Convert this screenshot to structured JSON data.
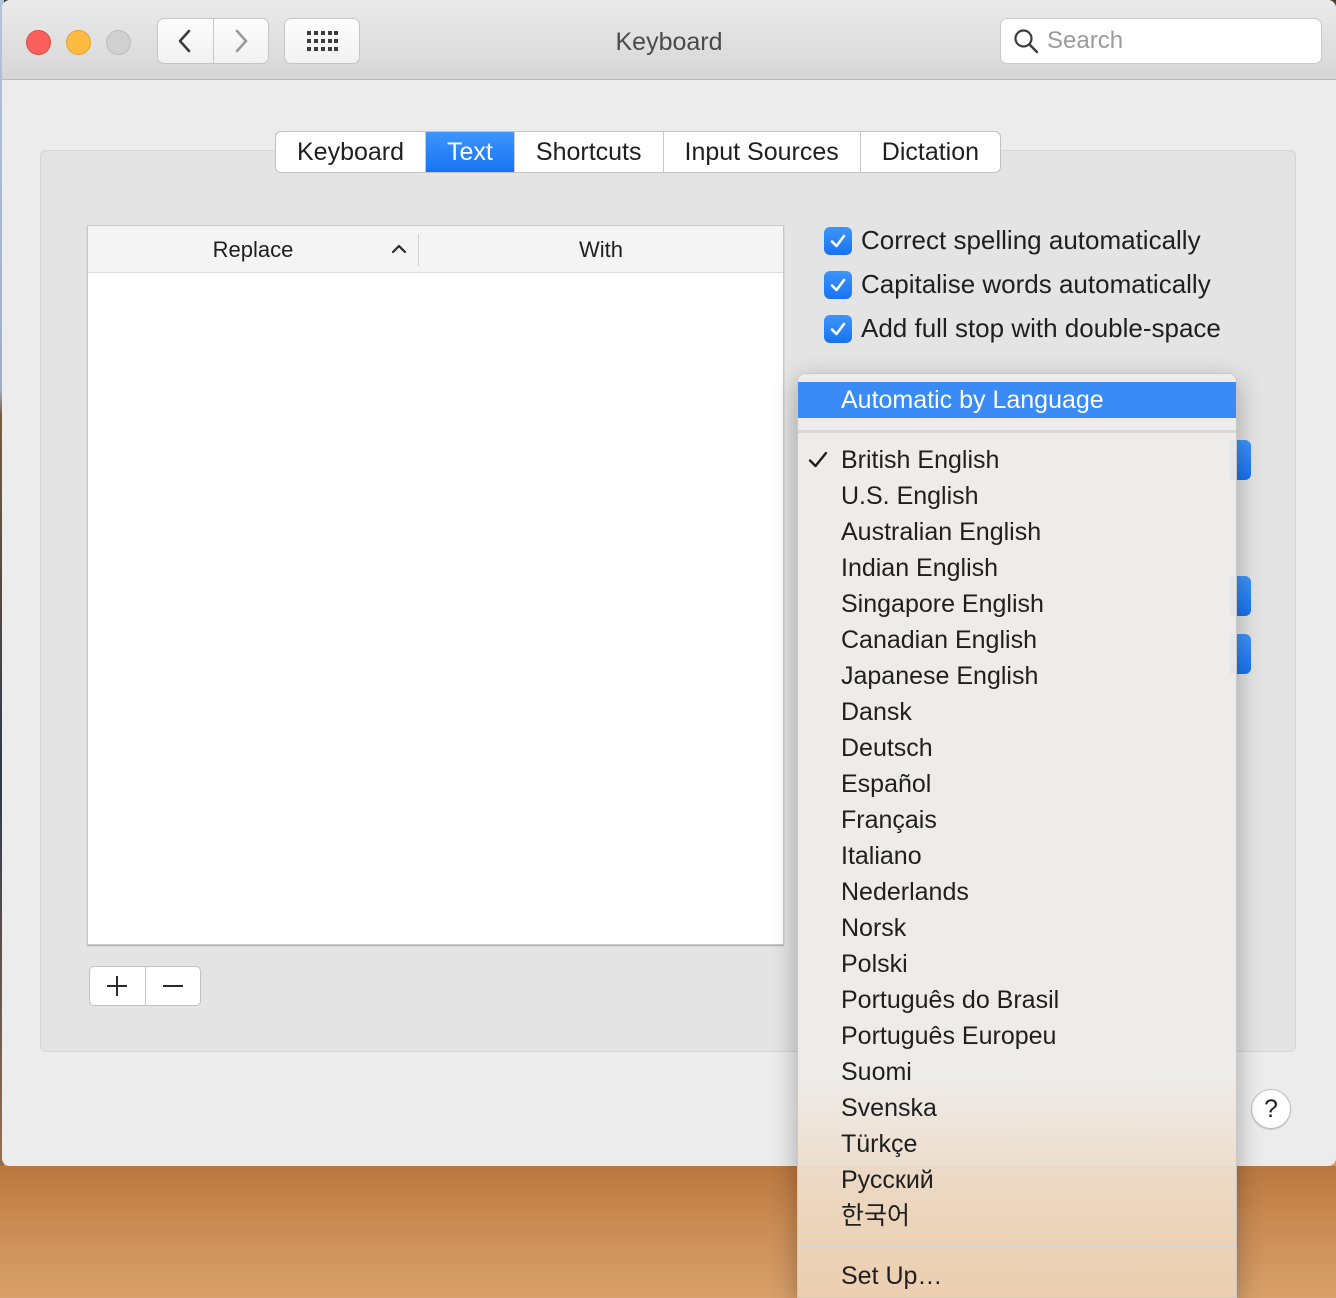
{
  "window": {
    "title": "Keyboard",
    "search_placeholder": "Search"
  },
  "tabs": [
    {
      "label": "Keyboard"
    },
    {
      "label": "Text"
    },
    {
      "label": "Shortcuts"
    },
    {
      "label": "Input Sources"
    },
    {
      "label": "Dictation"
    }
  ],
  "active_tab": "Text",
  "table": {
    "col_replace": "Replace",
    "col_with": "With",
    "sort": "ascending"
  },
  "options": {
    "spelling": "Correct spelling automatically",
    "capitalise": "Capitalise words automatically",
    "full_stop": "Add full stop with double-space"
  },
  "menu": {
    "top": "Automatic by Language",
    "languages": [
      "British English",
      "U.S. English",
      "Australian English",
      "Indian English",
      "Singapore English",
      "Canadian English",
      "Japanese English",
      "Dansk",
      "Deutsch",
      "Español",
      "Français",
      "Italiano",
      "Nederlands",
      "Norsk",
      "Polski",
      "Português do Brasil",
      "Português Europeu",
      "Suomi",
      "Svenska",
      "Türkçe",
      "Русский",
      "한국어"
    ],
    "checked": "British English",
    "setup": "Set Up…"
  },
  "help": "?",
  "colors": {
    "accent": "#1c7cf4",
    "highlight": "#3a8bf5",
    "close": "#fc605c",
    "minimize": "#fdbc40"
  }
}
